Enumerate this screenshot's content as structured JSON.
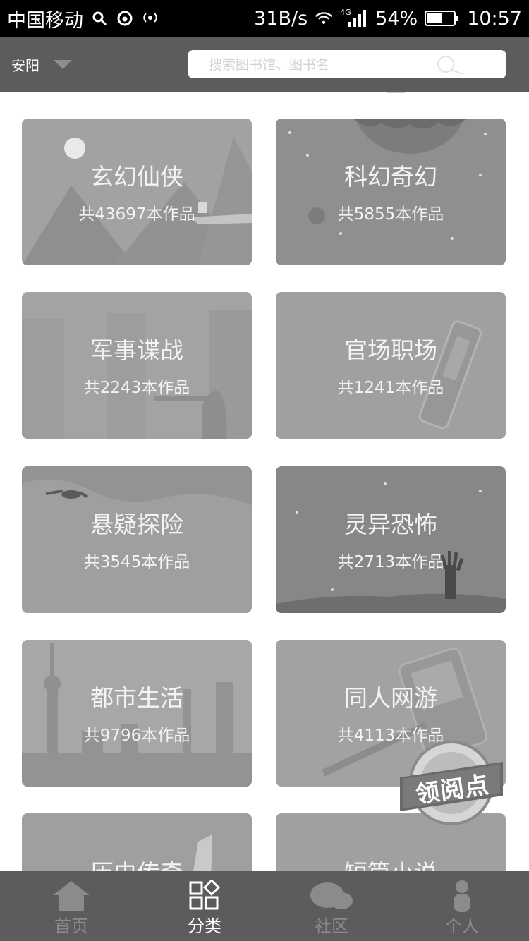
{
  "status_bar": {
    "carrier": "中国移动",
    "net_speed": "31B/s",
    "network_type": "4G",
    "battery_percent": "54%",
    "battery_level": 0.54,
    "time": "10:57",
    "icons": [
      "search-icon",
      "weibo-icon",
      "hotspot-icon",
      "wifi-icon",
      "signal-icon",
      "battery-icon"
    ]
  },
  "header": {
    "city": "安阳",
    "search_placeholder": "搜索图书馆、图书名"
  },
  "categories": [
    {
      "name": "玄幻仙侠",
      "count": "共43697本作品"
    },
    {
      "name": "科幻奇幻",
      "count": "共5855本作品"
    },
    {
      "name": "军事谍战",
      "count": "共2243本作品"
    },
    {
      "name": "官场职场",
      "count": "共1241本作品"
    },
    {
      "name": "悬疑探险",
      "count": "共3545本作品"
    },
    {
      "name": "灵异恐怖",
      "count": "共2713本作品"
    },
    {
      "name": "都市生活",
      "count": "共9796本作品"
    },
    {
      "name": "同人网游",
      "count": "共4113本作品"
    },
    {
      "name": "历史传奇",
      "count": ""
    },
    {
      "name": "短篇小说",
      "count": ""
    }
  ],
  "floating_badge": {
    "label": "领阅点"
  },
  "tab_bar": {
    "tabs": [
      {
        "label": "首页",
        "icon": "home-icon",
        "active": false
      },
      {
        "label": "分类",
        "icon": "category-icon",
        "active": true
      },
      {
        "label": "社区",
        "icon": "community-icon",
        "active": false
      },
      {
        "label": "个人",
        "icon": "person-icon",
        "active": false
      }
    ]
  },
  "colors": {
    "header_bg": "#5c5c5c",
    "tab_active": "#ffffff",
    "tab_inactive": "#8b8b8b"
  }
}
